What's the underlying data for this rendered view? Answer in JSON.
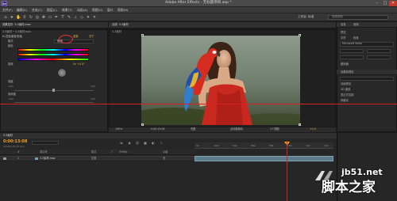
{
  "window": {
    "title": "Adobe After Effects - 无标题项目.aep *",
    "logo_text": "Ae",
    "minimize": "–",
    "maximize": "□",
    "close": "✕"
  },
  "menu": [
    "文件(F)",
    "编辑(E)",
    "合成(C)",
    "图层(L)",
    "效果(T)",
    "动画(A)",
    "视图(V)",
    "窗口",
    "帮助(H)"
  ],
  "toolbar": {
    "workspace_label": "工作区:",
    "workspace_value": "标准",
    "search_placeholder": "搜索帮助"
  },
  "effects_panel": {
    "tab": "效果控件: 3-3素材.mov",
    "layer": "3-3素材 • 3-3素材.mov",
    "effect_name": "fx 四色渐变/彩色",
    "reset": "重置",
    "about": "关于",
    "mode_label": "模式",
    "mode_value": "色调",
    "rows": [
      "颜色",
      "旋转",
      "强度",
      "饱和度"
    ],
    "values": [
      "0x +0.0°",
      "-100",
      "100",
      "0.0"
    ]
  },
  "comp_panel": {
    "tab": "合成: 3-3素材",
    "subtab": "3-3素材",
    "zoom": "100%",
    "timecode": "0:00:13:08",
    "quality": "完整",
    "camera": "活动摄像机",
    "view": "1个视图",
    "offset": "+0.0"
  },
  "right_panels": {
    "info_tab": "信息",
    "audio_tab": "音频",
    "preview_tab": "预览",
    "effects_tab": "效果和预设",
    "char_tab": "字符",
    "para_tab": "段落",
    "search_value": "",
    "font": "Microsoft YaHei",
    "tracker_label": "跟踪器",
    "items": [
      "动画预设",
      "3D 通道",
      "表达式控制",
      "风格化"
    ]
  },
  "timeline": {
    "tab": "3-3素材",
    "timecode": "0:00:13:08",
    "frames": "00328 (25.00 fps)",
    "headers": [
      "#",
      "源名称",
      "模式",
      "T",
      "TrkMat",
      "父级"
    ],
    "layer": {
      "index": "1",
      "name": "3-3素材.mov",
      "mode": "正常",
      "parent": "无"
    },
    "ruler_labels": [
      "0s",
      "02s",
      "04s",
      "06s",
      "08s",
      "10s",
      "12s",
      "14s"
    ]
  },
  "watermark": {
    "domain": "jb51.net",
    "site_name": "脚本之家"
  },
  "colors": {
    "accent_timecode": "#f0a020",
    "guide_line": "#d92020",
    "layer_bar": "#5c7c8c"
  }
}
